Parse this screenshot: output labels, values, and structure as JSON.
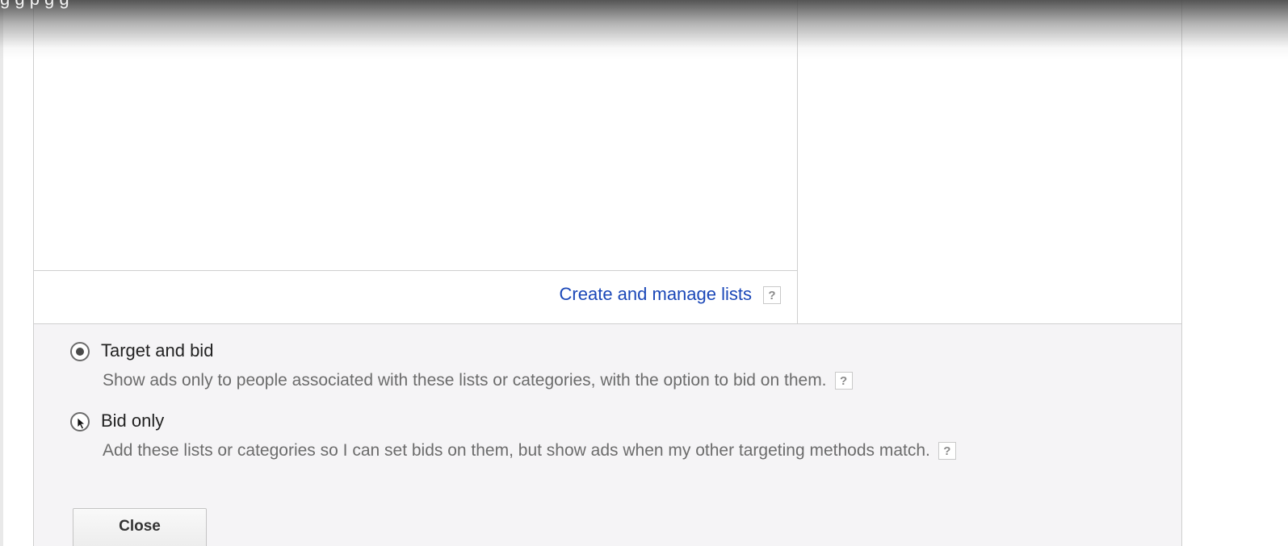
{
  "caption": {
    "text": "g                                            g        p g        g"
  },
  "lists": {
    "manage_link": "Create and manage lists",
    "help_label": "?"
  },
  "targeting_options": [
    {
      "label": "Target and bid",
      "description": "Show ads only to people associated with these lists or categories, with the option to bid on them.",
      "selected": true,
      "help_label": "?"
    },
    {
      "label": "Bid only",
      "description": "Add these lists or categories so I can set bids on them, but show ads when my other targeting methods match.",
      "selected": false,
      "help_label": "?"
    }
  ],
  "actions": {
    "close_label": "Close"
  },
  "colors": {
    "link": "#1a47b8",
    "options_background": "#f5f4f6",
    "border": "#cfcfcf"
  }
}
